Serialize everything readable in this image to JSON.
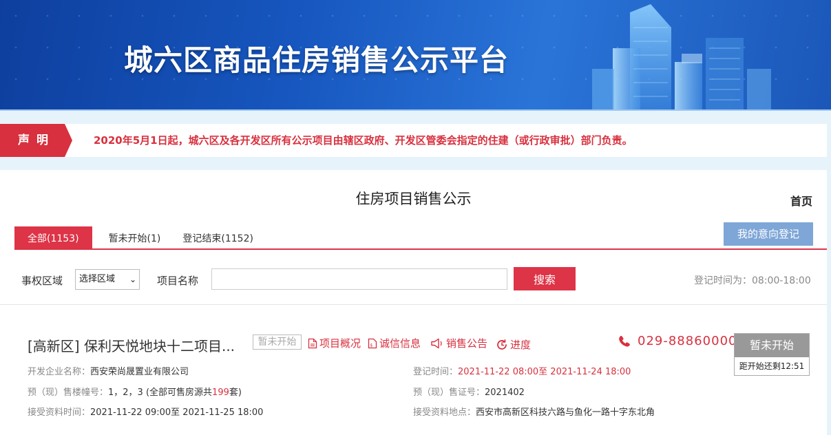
{
  "banner": {
    "title": "城六区商品住房销售公示平台"
  },
  "notice": {
    "tag": "声明",
    "text": "2020年5月1日起，城六区及各开发区所有公示项目由辖区政府、开发区管委会指定的住建（或行政审批）部门负责。"
  },
  "page": {
    "title": "住房项目销售公示",
    "home_link": "首页"
  },
  "tabs": [
    {
      "label": "全部(1153)",
      "active": true
    },
    {
      "label": "暂未开始(1)",
      "active": false
    },
    {
      "label": "登记结束(1152)",
      "active": false
    }
  ],
  "intent_button": "我的意向登记",
  "filters": {
    "region_label": "事权区域",
    "region_selected": "选择区域",
    "name_label": "项目名称",
    "name_value": "",
    "search_button": "搜索",
    "reg_time": "登记时间为：08:00-18:00"
  },
  "project": {
    "title": "[高新区] 保利天悦地块十二项目...",
    "status_badge": "暂未开始",
    "links": [
      "项目概况",
      "诚信信息",
      "销售公告",
      "进度"
    ],
    "phone": "029-88860000",
    "status_box": {
      "label": "暂未开始",
      "countdown": "距开始还剩12:51"
    },
    "developer_key": "开发企业名称：",
    "developer_val": "西安荣尚晟置业有限公司",
    "buildings_key": "预（现）售楼幢号：",
    "buildings_val": "1，2，3 (全部可售房源共",
    "buildings_count": "199",
    "buildings_suffix": "套)",
    "accept_time_key": "接受资料时间：",
    "accept_time_val": "2021-11-22 09:00至 2021-11-25 18:00",
    "reg_time_key": "登记时间：",
    "reg_time_val": "2021-11-22 08:00至 2021-11-24 18:00",
    "permit_key": "预（现）售证号：",
    "permit_val": "2021402",
    "accept_place_key": "接受资料地点：",
    "accept_place_val": "西安市高新区科技六路与鱼化一路十字东北角"
  },
  "colors": {
    "brand_red": "#dd3447",
    "banner_blue": "#1656be",
    "intent_blue": "#7ea6d7"
  }
}
